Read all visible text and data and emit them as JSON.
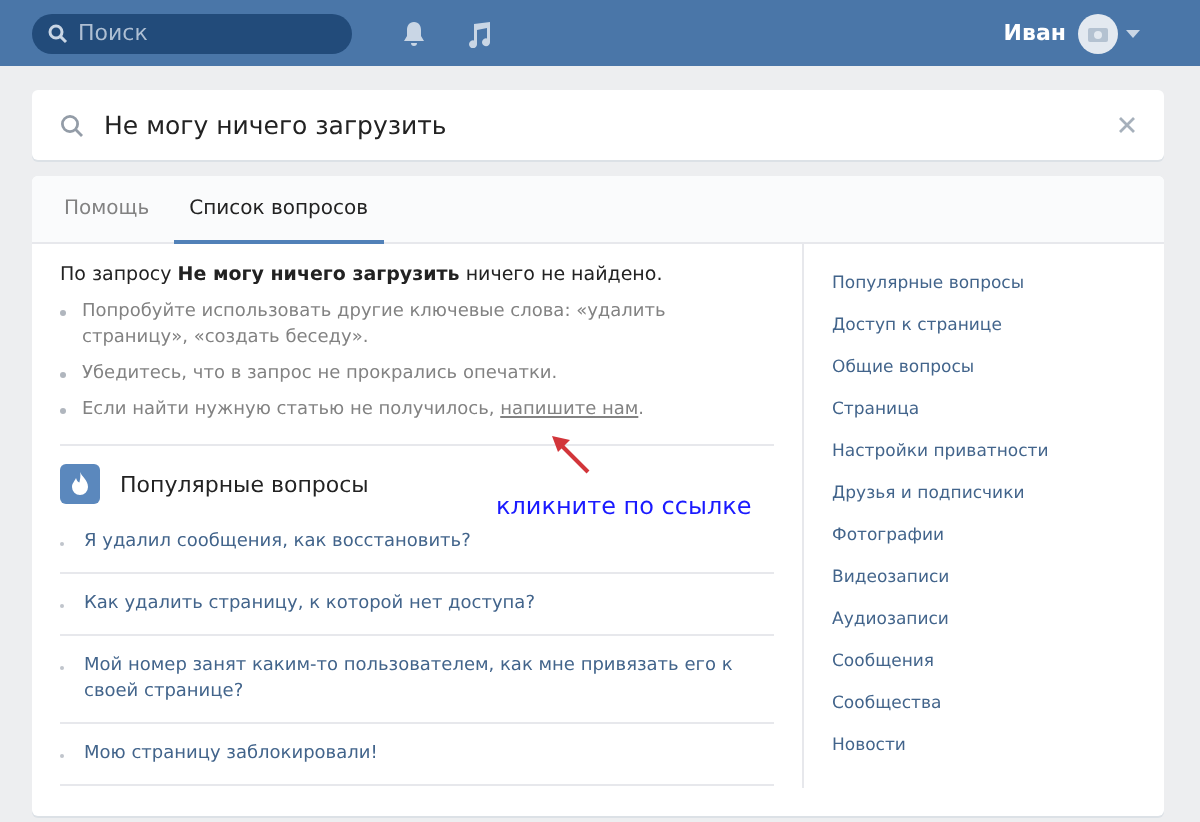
{
  "header": {
    "search": {
      "placeholder": "Поиск"
    },
    "user_name": "Иван"
  },
  "search": {
    "value": "Не могу ничего загрузить"
  },
  "tabs": [
    {
      "label": "Помощь",
      "selected": false
    },
    {
      "label": "Список вопросов",
      "selected": true
    }
  ],
  "result_message": "По запросу **Не могу ничего загрузить** ничего не найдено.",
  "tips": [
    {
      "text": "Попробуйте использовать другие ключевые слова: «удалить страницу», «создать беседу»."
    },
    {
      "text": "Убедитесь, что в запрос не прокрались опечатки."
    },
    {
      "text": "Если найти нужную статью не получилось, ",
      "link": "напишите нам",
      "tail": "."
    }
  ],
  "popular": {
    "title": "Популярные вопросы",
    "questions": [
      "Я удалил сообщения, как восстановить?",
      "Как удалить страницу, к которой нет доступа?",
      "Мой номер занят каким-то пользователем, как мне привязать его к своей странице?",
      "Мою страницу заблокировали!"
    ]
  },
  "sidebar": {
    "items": [
      "Популярные вопросы",
      "Доступ к странице",
      "Общие вопросы",
      "Страница",
      "Настройки приватности",
      "Друзья и подписчики",
      "Фотографии",
      "Видеозаписи",
      "Аудиозаписи",
      "Сообщения",
      "Сообщества",
      "Новости"
    ]
  },
  "annotation": {
    "text": "кликните по ссылке"
  }
}
